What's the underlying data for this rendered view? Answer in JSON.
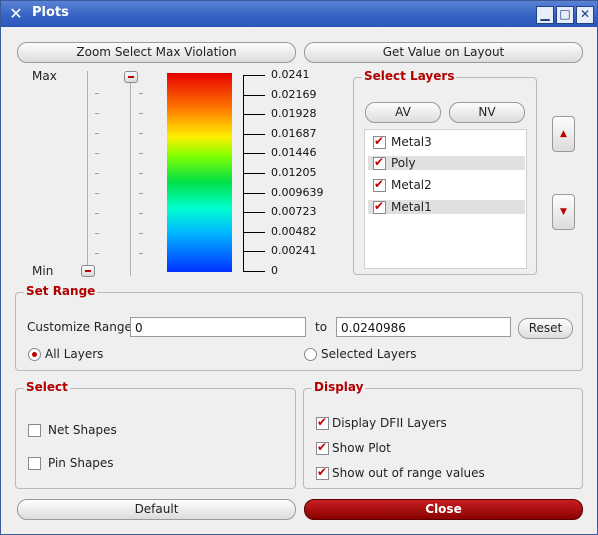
{
  "window": {
    "title": "Plots",
    "app_icon": "x-icon"
  },
  "titlebar_buttons": {
    "minimize": "▁",
    "maximize": "□",
    "close": "✕"
  },
  "top_buttons": {
    "zoom": "Zoom Select Max Violation",
    "get_value": "Get Value on Layout"
  },
  "slider": {
    "max_label": "Max",
    "min_label": "Min"
  },
  "scale": {
    "ticks": [
      "0.0241",
      "0.02169",
      "0.01928",
      "0.01687",
      "0.01446",
      "0.01205",
      "0.009639",
      "0.00723",
      "0.00482",
      "0.00241",
      "0"
    ]
  },
  "select_layers": {
    "title": "Select Layers",
    "av_button": "AV",
    "nv_button": "NV",
    "layers": [
      {
        "name": "Metal3",
        "checked": true
      },
      {
        "name": "Poly",
        "checked": true
      },
      {
        "name": "Metal2",
        "checked": true
      },
      {
        "name": "Metal1",
        "checked": true
      }
    ]
  },
  "side_buttons": {
    "up": "▲",
    "down": "▼"
  },
  "set_range": {
    "title": "Set Range",
    "customize_label": "Customize Range",
    "from_value": "0",
    "to_label": "to",
    "to_value": "0.0240986",
    "reset_label": "Reset",
    "all_layers_label": "All Layers",
    "selected_layers_label": "Selected Layers",
    "selected_option": "All Layers"
  },
  "select_group": {
    "title": "Select",
    "net_shapes": "Net Shapes",
    "pin_shapes": "Pin Shapes"
  },
  "display_group": {
    "title": "Display",
    "display_dfii": "Display DFII Layers",
    "show_plot": "Show Plot",
    "show_out_of_range": "Show out of range values"
  },
  "bottom_buttons": {
    "default": "Default",
    "close": "Close"
  },
  "colors": {
    "accent": "#c00000",
    "titlebar": "#3462c4",
    "close_button": "#8b0000"
  }
}
